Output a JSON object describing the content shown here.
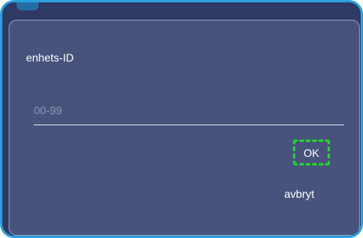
{
  "dialog": {
    "title": "enhets-ID",
    "input": {
      "value": "",
      "placeholder": "00-99"
    },
    "ok_label": "OK",
    "cancel_label": "avbryt"
  },
  "colors": {
    "dialog_background": "#47537c",
    "frame_border": "#2aa0df",
    "highlight": "#21d42b",
    "text": "#ffffff"
  }
}
